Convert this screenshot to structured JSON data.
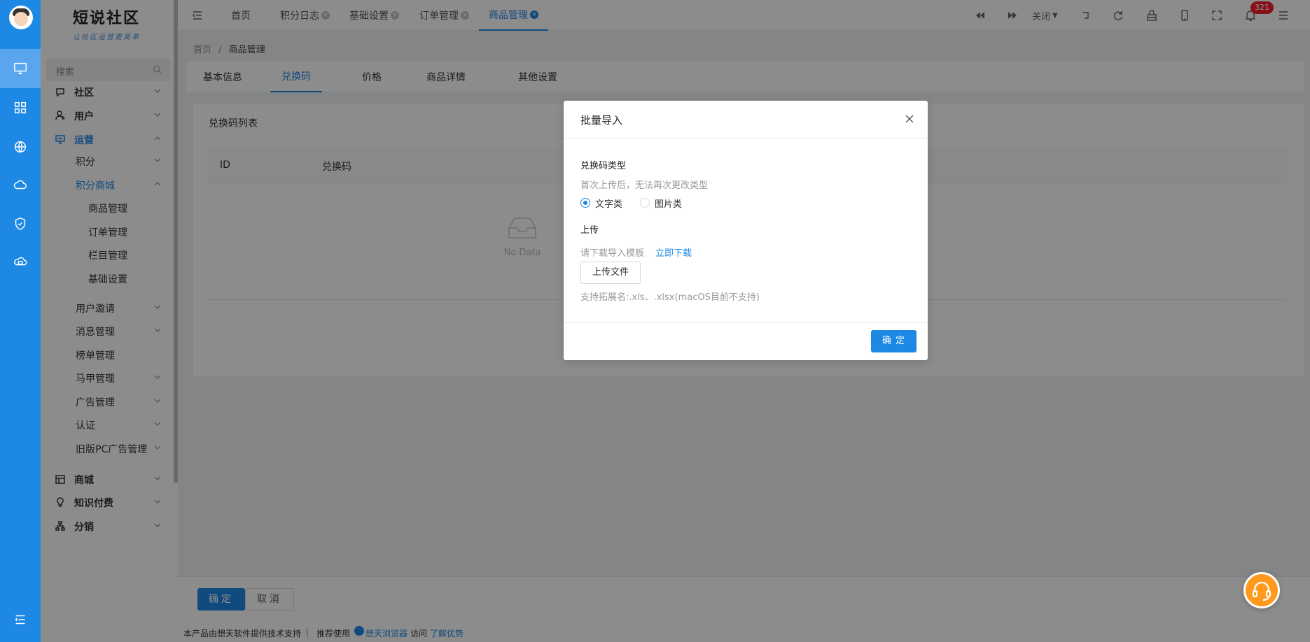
{
  "brand": {
    "title": "短说社区",
    "subtitle": "让社区运营更简单"
  },
  "search": {
    "placeholder": "搜索"
  },
  "menu": {
    "items": [
      {
        "label": "社区",
        "icon": "chat-icon",
        "level": 1
      },
      {
        "label": "用户",
        "icon": "user-icon",
        "level": 1
      },
      {
        "label": "运营",
        "icon": "monitor-icon",
        "level": 1
      },
      {
        "label": "积分",
        "level": 2
      },
      {
        "label": "积分商城",
        "level": 2
      },
      {
        "label": "商品管理",
        "level": 3
      },
      {
        "label": "订单管理",
        "level": 3
      },
      {
        "label": "栏目管理",
        "level": 3
      },
      {
        "label": "基础设置",
        "level": 3
      },
      {
        "label": "用户邀请",
        "level": 2
      },
      {
        "label": "消息管理",
        "level": 2
      },
      {
        "label": "榜单管理",
        "level": 2
      },
      {
        "label": "马甲管理",
        "level": 2
      },
      {
        "label": "广告管理",
        "level": 2
      },
      {
        "label": "认证",
        "level": 2
      },
      {
        "label": "旧版PC广告管理",
        "level": 2
      },
      {
        "label": "商城",
        "icon": "shop-icon",
        "level": 1
      },
      {
        "label": "知识付费",
        "icon": "bulb-icon",
        "level": 1
      },
      {
        "label": "分销",
        "icon": "org-icon",
        "level": 1
      }
    ]
  },
  "topbar": {
    "tabs": [
      {
        "label": "首页",
        "closable": false
      },
      {
        "label": "积分日志",
        "closable": true
      },
      {
        "label": "基础设置",
        "closable": true
      },
      {
        "label": "订单管理",
        "closable": true
      },
      {
        "label": "商品管理",
        "closable": true,
        "active": true
      }
    ],
    "close_label": "关闭",
    "notification_count": "321"
  },
  "breadcrumb": {
    "home": "首页",
    "separator": "/",
    "current": "商品管理"
  },
  "subtabs": [
    "基本信息",
    "兑换码",
    "价格",
    "商品详情",
    "其他设置"
  ],
  "panel": {
    "title": "兑换码列表",
    "columns": [
      "ID",
      "兑换码"
    ],
    "empty_text": "No Data"
  },
  "footer": {
    "confirm": "确定",
    "cancel": "取消"
  },
  "bottom": {
    "support_text": "本产品由想天软件提供技术支持",
    "sep": "|",
    "recommend": "推荐使用",
    "browser": "想天浏览器",
    "visit": "访问",
    "learn": "了解优势"
  },
  "modal": {
    "title": "批量导入",
    "type_label": "兑换码类型",
    "type_hint": "首次上传后，无法再次更改类型",
    "options": [
      "文字类",
      "图片类"
    ],
    "selected_option": "文字类",
    "upload_label": "上传",
    "template_hint": "请下载导入模板",
    "download_link": "立即下载",
    "upload_button": "上传文件",
    "ext_hint": "支持拓展名:.xls、.xlsx(macOS目前不支持)",
    "confirm": "确 定"
  },
  "colors": {
    "primary": "#1e88e5",
    "badge": "#f5222d",
    "support": "#ff9a1f"
  }
}
